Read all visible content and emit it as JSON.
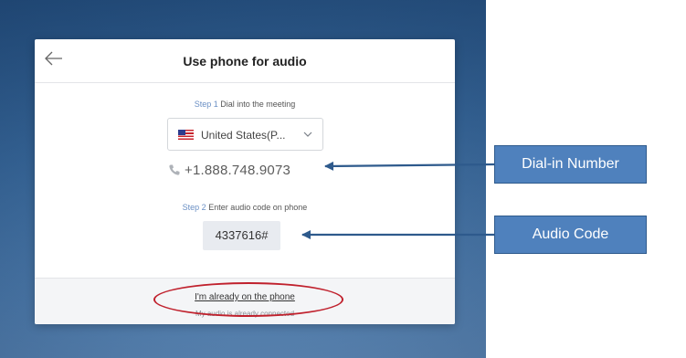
{
  "dialog": {
    "title": "Use phone for audio",
    "step1": {
      "number": "Step 1",
      "text": "Dial into the meeting"
    },
    "country": {
      "selected": "United States(P..."
    },
    "phone_number": "+1.888.748.9073",
    "step2": {
      "number": "Step 2",
      "text": "Enter audio code on phone"
    },
    "audio_code": "4337616#",
    "footer": {
      "link": "I'm already on the phone",
      "subtext": "My audio is already connected"
    }
  },
  "annotations": {
    "dial_in_label": "Dial-in Number",
    "audio_code_label": "Audio Code"
  },
  "colors": {
    "callout": "#4f81bd",
    "arrow": "#2e5a8c",
    "highlight_ellipse": "#c0212d"
  },
  "icons": [
    "back-arrow-icon",
    "us-flag-icon",
    "chevron-down-icon",
    "phone-icon"
  ]
}
